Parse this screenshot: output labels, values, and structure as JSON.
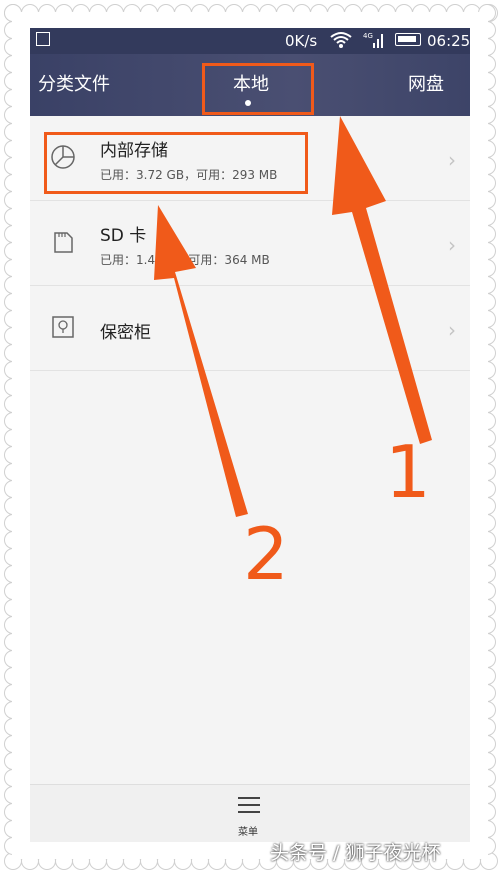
{
  "status_bar": {
    "speed": "0K/s",
    "time": "06:25",
    "network_badge": "4G",
    "icons": [
      "gallery-icon",
      "wifi-icon",
      "signal-icon",
      "battery-icon"
    ]
  },
  "nav": {
    "tabs": [
      {
        "label": "分类文件"
      },
      {
        "label": "本地"
      },
      {
        "label": "网盘"
      }
    ],
    "active_tab": "本地"
  },
  "storage": {
    "items": [
      {
        "title": "内部存储",
        "subtitle": "已用：3.72 GB，可用：293 MB",
        "icon": "pie-chart-icon"
      },
      {
        "title": "SD 卡",
        "subtitle": "已用：1.4 GB，可用：364 MB",
        "icon": "sd-card-icon"
      },
      {
        "title": "保密柜",
        "subtitle": "",
        "icon": "safe-icon"
      }
    ]
  },
  "bottom": {
    "menu_label": "菜单"
  },
  "annotations": {
    "label_1": "1",
    "label_2": "2",
    "color": "#f05a1a"
  },
  "watermark": "头条号 / 狮子夜光杯"
}
